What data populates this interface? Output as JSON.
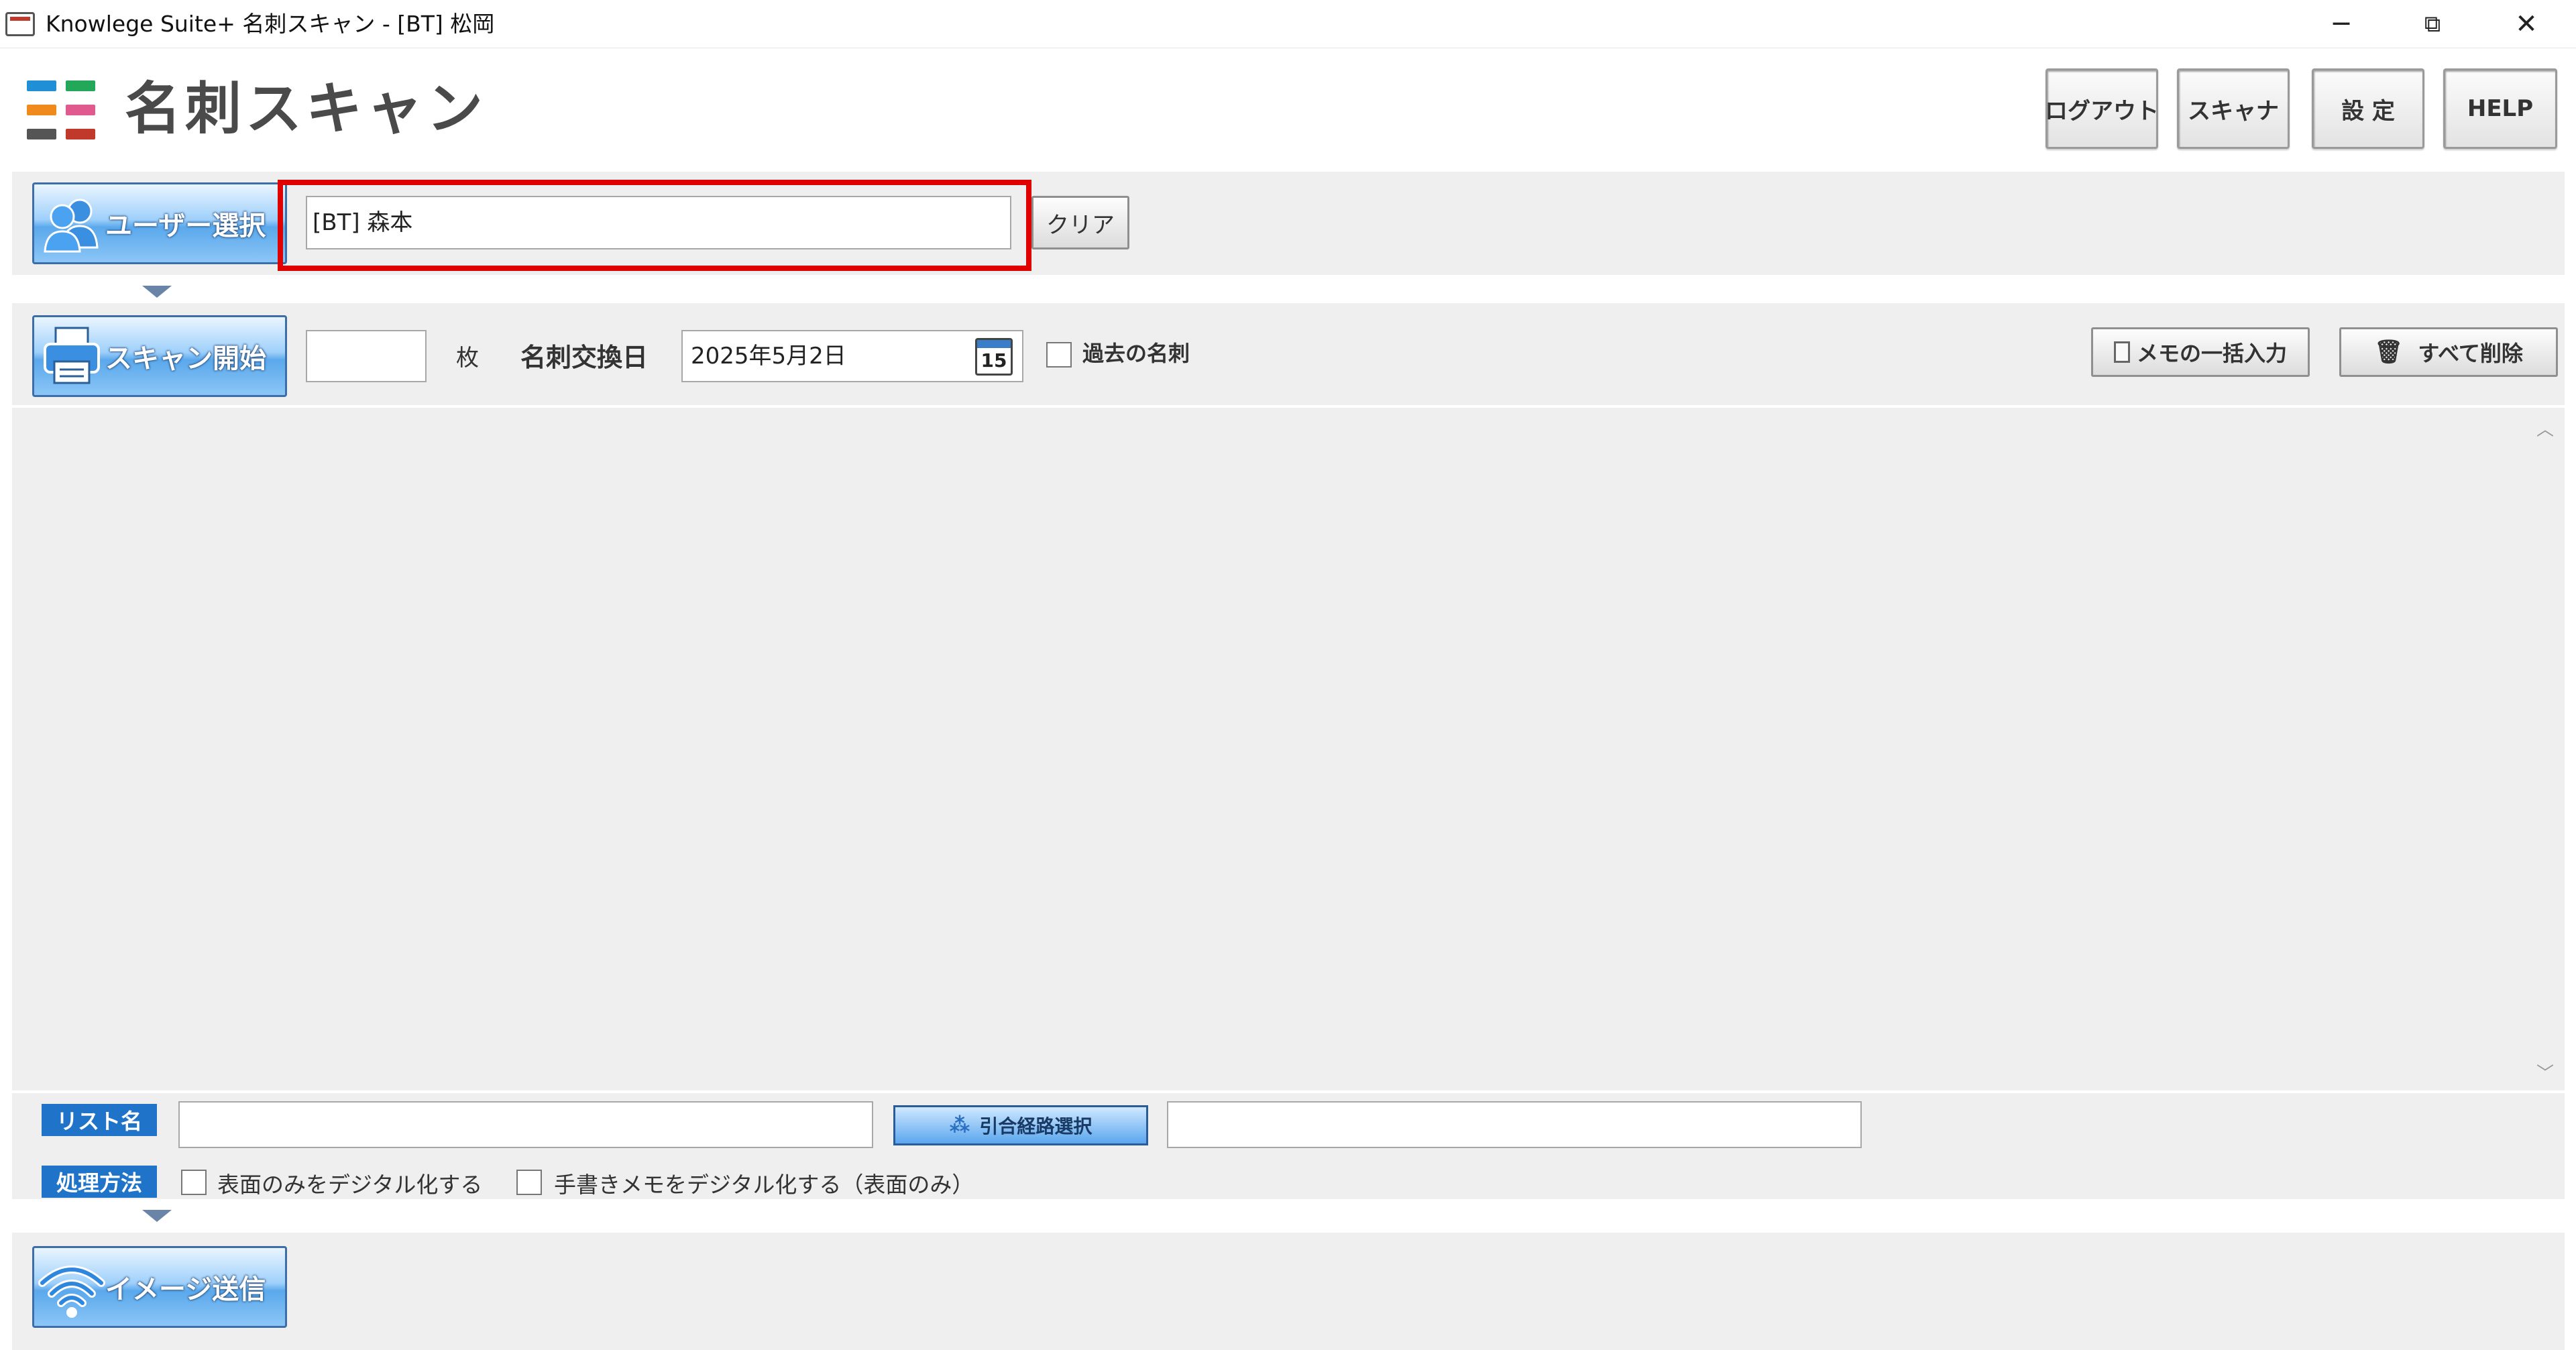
{
  "window": {
    "title": "Knowlege Suite+ 名刺スキャン - [BT] 松岡",
    "minimize_glyph": "─",
    "restore_glyph": "⧉",
    "close_glyph": "✕"
  },
  "header": {
    "app_title": "名刺スキャン",
    "buttons": {
      "logout": "ログアウト",
      "scanner": "スキャナ",
      "settings": "設 定",
      "help": "HELP"
    }
  },
  "user_section": {
    "select_button": "ユーザー選択",
    "user_value": "[BT] 森本",
    "clear_button": "クリア"
  },
  "scan_section": {
    "start_button": "スキャン開始",
    "count_value": "",
    "count_unit": "枚",
    "date_label": "名刺交換日",
    "date_value": "2025年5月2日",
    "calendar_day": "15",
    "past_card_label": "過去の名刺",
    "memo_bulk_button": "メモの一括入力",
    "delete_all_button": "すべて削除"
  },
  "bottom_section": {
    "list_name_tag": "リスト名",
    "list_name_value": "",
    "route_button": "引合経路選択",
    "route_value": "",
    "method_tag": "処理方法",
    "option_front_only": "表面のみをデジタル化する",
    "option_handwritten": "手書きメモをデジタル化する（表面のみ）",
    "send_button": "イメージ送信"
  },
  "colors": {
    "highlight": "#e00000",
    "accent_blue": "#1f74c9"
  }
}
